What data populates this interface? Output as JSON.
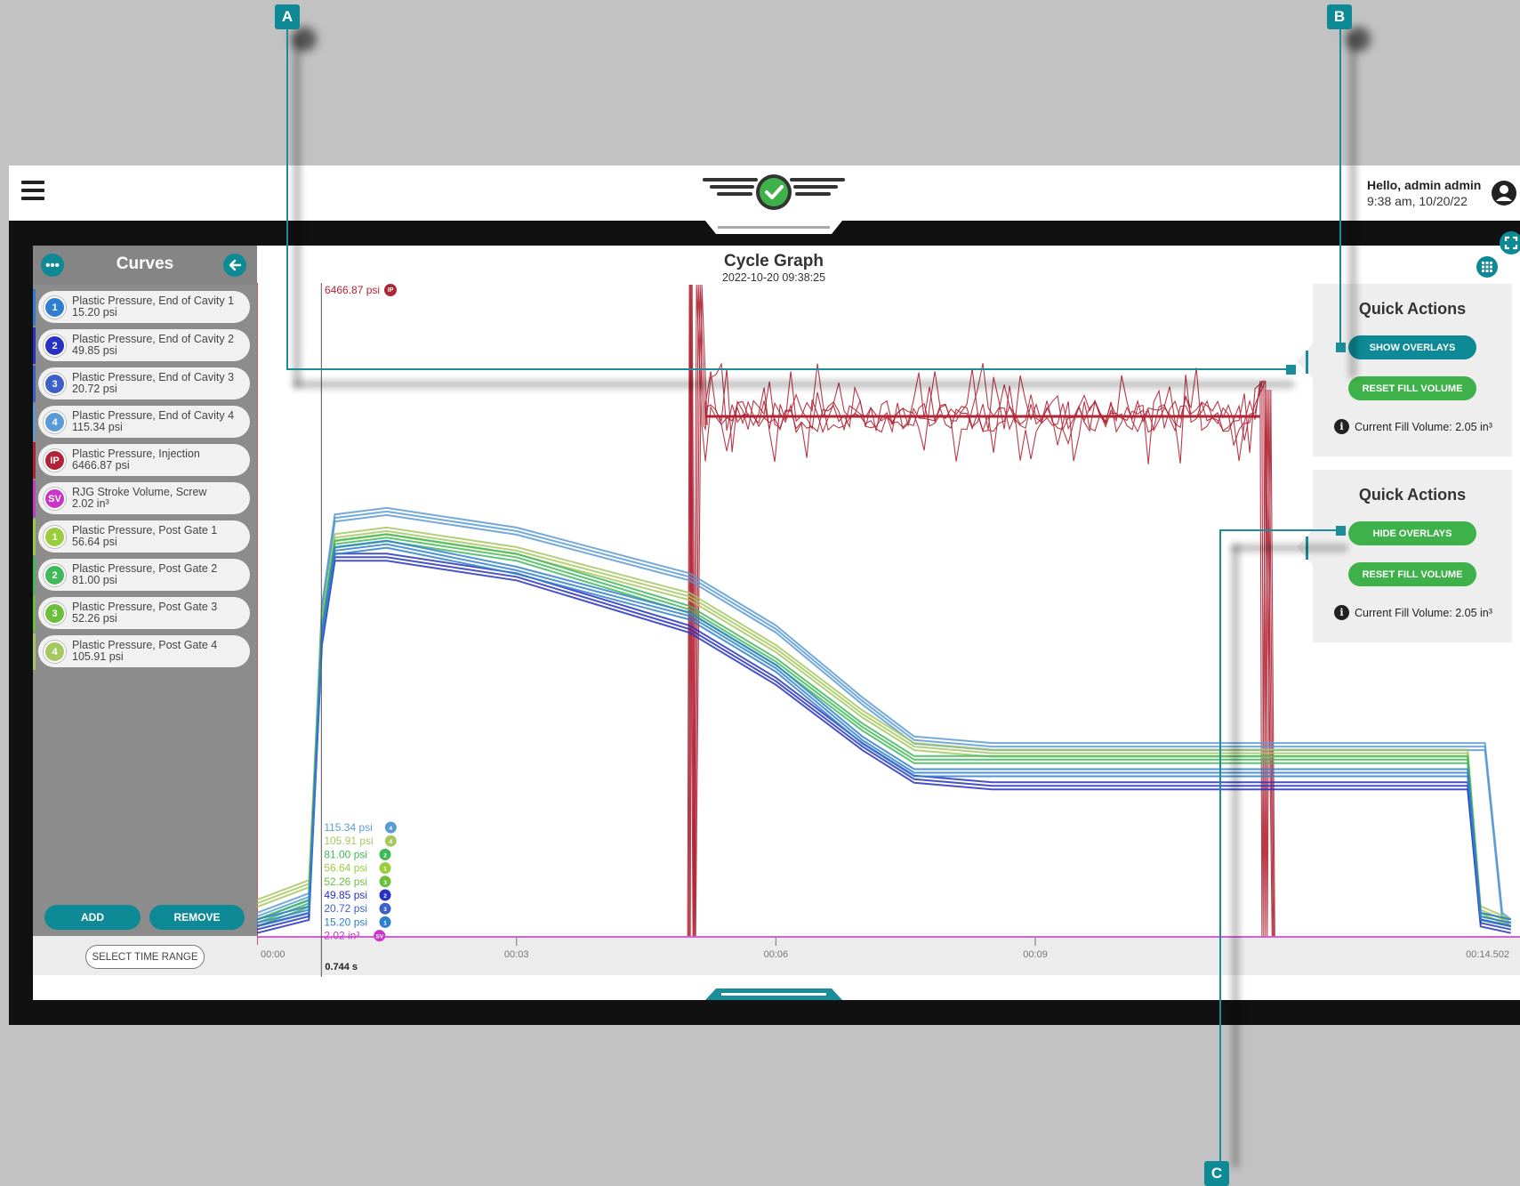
{
  "callouts": {
    "a": "A",
    "b": "B",
    "c": "C"
  },
  "header": {
    "greeting": "Hello, admin admin",
    "datetime": "9:38 am, 10/20/22"
  },
  "sidebar": {
    "title": "Curves",
    "items": [
      {
        "badge": "1",
        "name": "Plastic Pressure, End of Cavity 1",
        "value": "15.20 psi",
        "color": "#2f7fd0"
      },
      {
        "badge": "2",
        "name": "Plastic Pressure, End of Cavity 2",
        "value": "49.85 psi",
        "color": "#2732c2"
      },
      {
        "badge": "3",
        "name": "Plastic Pressure, End of Cavity 3",
        "value": "20.72 psi",
        "color": "#3c5fc8"
      },
      {
        "badge": "4",
        "name": "Plastic Pressure, End of Cavity 4",
        "value": "115.34 psi",
        "color": "#5b9bd5"
      },
      {
        "badge": "IP",
        "name": "Plastic Pressure, Injection",
        "value": "6466.87 psi",
        "color": "#b02535"
      },
      {
        "badge": "SV",
        "name": "RJG Stroke Volume, Screw",
        "value": "2.02 in³",
        "color": "#c935c9"
      },
      {
        "badge": "1",
        "name": "Plastic Pressure, Post Gate 1",
        "value": "56.64 psi",
        "color": "#9acd3c"
      },
      {
        "badge": "2",
        "name": "Plastic Pressure, Post Gate 2",
        "value": "81.00 psi",
        "color": "#3fb95a"
      },
      {
        "badge": "3",
        "name": "Plastic Pressure, Post Gate 3",
        "value": "52.26 psi",
        "color": "#6cbf3a"
      },
      {
        "badge": "4",
        "name": "Plastic Pressure, Post Gate 4",
        "value": "105.91 psi",
        "color": "#a6c860"
      }
    ],
    "add_label": "ADD",
    "remove_label": "REMOVE",
    "select_time_range_label": "SELECT TIME RANGE"
  },
  "graph": {
    "title": "Cycle Graph",
    "subtitle": "2022-10-20  09:38:25",
    "ip_label": "6466.87 psi",
    "cursor_time": "0.744 s"
  },
  "chart_data": {
    "type": "line",
    "x_unit": "s",
    "x_ticks": [
      "00:00",
      "00:03",
      "00:06",
      "00:09",
      "00:14.502"
    ],
    "x_range": [
      0,
      14.502
    ],
    "cursor_x": 0.744,
    "series_labels": [
      {
        "text": "115.34 psi",
        "badge": "4",
        "color": "#5b9bd5"
      },
      {
        "text": "105.91 psi",
        "badge": "4",
        "color": "#a6c860"
      },
      {
        "text": "81.00 psi",
        "badge": "2",
        "color": "#3fb95a"
      },
      {
        "text": "56.64 psi",
        "badge": "1",
        "color": "#9acd3c"
      },
      {
        "text": "52.26 psi",
        "badge": "3",
        "color": "#6cbf3a"
      },
      {
        "text": "49.85 psi",
        "badge": "2",
        "color": "#2732c2"
      },
      {
        "text": "20.72 psi",
        "badge": "3",
        "color": "#3c5fc8"
      },
      {
        "text": "15.20 psi",
        "badge": "1",
        "color": "#2f7fd0"
      },
      {
        "text": "2.02 in³",
        "badge": "SV",
        "color": "#c935c9"
      }
    ],
    "cavity_series": [
      {
        "color": "#5b9bd5",
        "points": [
          [
            0,
            0.03
          ],
          [
            0.6,
            0.06
          ],
          [
            0.75,
            0.5
          ],
          [
            0.9,
            0.64
          ],
          [
            1.5,
            0.65
          ],
          [
            3,
            0.62
          ],
          [
            5,
            0.55
          ],
          [
            6,
            0.47
          ],
          [
            7,
            0.36
          ],
          [
            7.6,
            0.3
          ],
          [
            8.5,
            0.29
          ],
          [
            14.2,
            0.29
          ],
          [
            14.4,
            0.03
          ],
          [
            14.5,
            0.02
          ]
        ]
      },
      {
        "color": "#a6c860",
        "points": [
          [
            0,
            0.05
          ],
          [
            0.6,
            0.08
          ],
          [
            0.75,
            0.48
          ],
          [
            0.9,
            0.61
          ],
          [
            1.5,
            0.62
          ],
          [
            3,
            0.59
          ],
          [
            5,
            0.52
          ],
          [
            6,
            0.44
          ],
          [
            7,
            0.34
          ],
          [
            7.6,
            0.29
          ],
          [
            8.5,
            0.28
          ],
          [
            14,
            0.28
          ],
          [
            14.15,
            0.04
          ],
          [
            14.5,
            0.02
          ]
        ]
      },
      {
        "color": "#3fb95a",
        "points": [
          [
            0,
            0.02
          ],
          [
            0.6,
            0.05
          ],
          [
            0.75,
            0.47
          ],
          [
            0.9,
            0.6
          ],
          [
            1.5,
            0.61
          ],
          [
            3,
            0.58
          ],
          [
            5,
            0.5
          ],
          [
            6,
            0.42
          ],
          [
            7,
            0.32
          ],
          [
            7.6,
            0.27
          ],
          [
            8.5,
            0.27
          ],
          [
            14,
            0.27
          ],
          [
            14.15,
            0.03
          ],
          [
            14.5,
            0.02
          ]
        ]
      },
      {
        "color": "#2732c2",
        "points": [
          [
            0,
            0.01
          ],
          [
            0.6,
            0.03
          ],
          [
            0.75,
            0.45
          ],
          [
            0.9,
            0.58
          ],
          [
            1.5,
            0.58
          ],
          [
            3,
            0.55
          ],
          [
            5,
            0.47
          ],
          [
            6,
            0.39
          ],
          [
            7,
            0.29
          ],
          [
            7.6,
            0.24
          ],
          [
            8.5,
            0.23
          ],
          [
            14,
            0.23
          ],
          [
            14.15,
            0.02
          ],
          [
            14.5,
            0.01
          ]
        ]
      },
      {
        "color": "#2f7fd0",
        "points": [
          [
            0,
            0.02
          ],
          [
            0.6,
            0.04
          ],
          [
            0.75,
            0.46
          ],
          [
            0.9,
            0.59
          ],
          [
            1.5,
            0.6
          ],
          [
            3,
            0.56
          ],
          [
            5,
            0.49
          ],
          [
            6,
            0.41
          ],
          [
            7,
            0.3
          ],
          [
            7.6,
            0.25
          ],
          [
            8.5,
            0.25
          ],
          [
            14,
            0.25
          ],
          [
            14.15,
            0.03
          ],
          [
            14.5,
            0.02
          ]
        ]
      }
    ],
    "injection_series": {
      "color": "#b02535",
      "peak_start": 5.0,
      "hold_end": 11.6,
      "drop": 11.8
    }
  },
  "quick_actions": [
    {
      "title": "Quick Actions",
      "overlay_label": "SHOW OVERLAYS",
      "overlay_color": "#0e8a96",
      "reset_label": "RESET FILL VOLUME",
      "fill_volume_text": "Current Fill Volume: 2.05 in³"
    },
    {
      "title": "Quick Actions",
      "overlay_label": "HIDE OVERLAYS",
      "overlay_color": "#3fb14a",
      "reset_label": "RESET FILL VOLUME",
      "fill_volume_text": "Current Fill Volume: 2.05 in³"
    }
  ],
  "colors": {
    "accent": "#0e8a96",
    "green": "#3fb14a",
    "ip_red": "#b02535"
  }
}
